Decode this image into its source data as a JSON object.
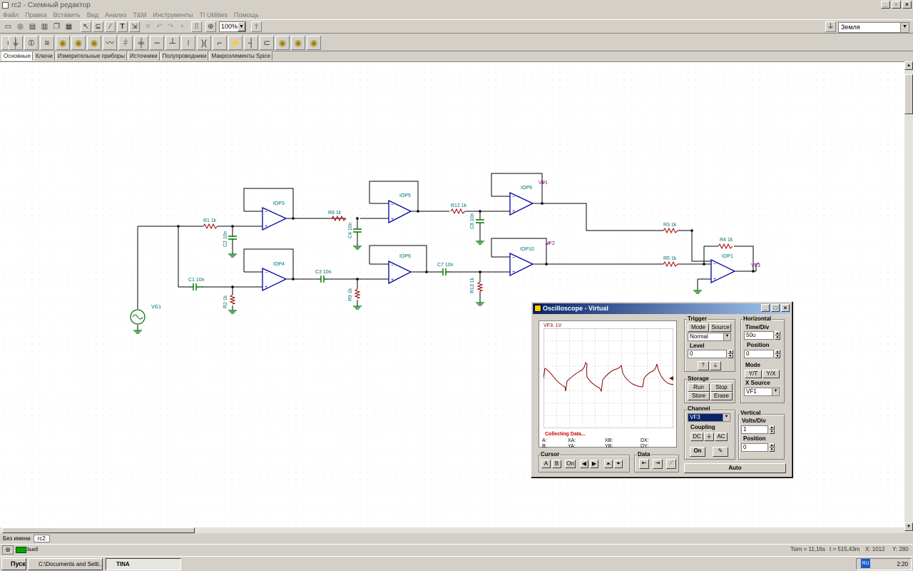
{
  "window": {
    "title": "rc2 - Схемный редактор"
  },
  "menu": [
    "Файл",
    "Правка",
    "Вставить",
    "Вид",
    "Анализ",
    "T&M",
    "Инструменты",
    "TI Utilities",
    "Помощь"
  ],
  "toolbar": {
    "zoom": "100%",
    "ground_select": "Земля"
  },
  "component_tabs": [
    "Основные",
    "Ключи",
    "Измерительные приборы",
    "Источники",
    "Полупроводники",
    "Макроэлементы Spice"
  ],
  "circuit": {
    "labels": {
      "vg1": "VG1",
      "r1": "R1 1k",
      "c2": "C2 10n",
      "iop3": "IOP3",
      "c1": "C1 10n",
      "r2": "R2 1k",
      "iop4": "IOP4",
      "r8": "R8 1k",
      "c4": "C4 10n",
      "iop5": "IOP5",
      "c3": "C3 10n",
      "r9": "R9 1k",
      "iop6": "IOP6",
      "r12": "R12 1k",
      "c8": "C8 10n",
      "iop9": "IOP9",
      "vf1": "VF1",
      "c7": "C7 10n",
      "r13": "R13 1k",
      "iop10": "IOP10",
      "vf2": "VF2",
      "r3": "R3 1k",
      "r4": "R4 1k",
      "r5": "R5 1k",
      "iop1": "IOP1",
      "vf3": "VF3"
    }
  },
  "oscilloscope": {
    "title": "Oscilloscope - Virtual",
    "screen_label": "VF3: 1V",
    "status": "Collecting Data...",
    "readouts": {
      "a": "A:",
      "xa": "XA:",
      "xb": "XB:",
      "dx": "DX:",
      "b": "B:",
      "ya": "YA:",
      "yb": "YB:",
      "dy": "DY:"
    },
    "trigger": {
      "label": "Trigger",
      "mode": "Mode",
      "source": "Source",
      "mode_value": "Normal",
      "level_label": "Level",
      "level": "0"
    },
    "horizontal": {
      "label": "Horizontal",
      "time_div_label": "Time/Div",
      "time_div": "50u",
      "position_label": "Position",
      "position": "0",
      "mode_label": "Mode",
      "yt": "Y/T",
      "yx": "Y/X",
      "xsource_label": "X Source",
      "xsource": "VF1"
    },
    "storage": {
      "label": "Storage",
      "run": "Run",
      "stop": "Stop",
      "store": "Store",
      "erase": "Erase"
    },
    "channel": {
      "label": "Channel",
      "value": "VF3",
      "coupling_label": "Coupling",
      "dc": "DC",
      "ac": "AC",
      "on": "On"
    },
    "vertical": {
      "label": "Vertical",
      "volts_div_label": "Volts/Div",
      "volts_div": "1",
      "position_label": "Position",
      "position": "0"
    },
    "cursor": {
      "label": "Cursor",
      "a": "A",
      "b": "B",
      "on": "On"
    },
    "data_label": "Data",
    "auto": "Auto"
  },
  "sheet_tabs": [
    "Без имени",
    "rc2"
  ],
  "status": {
    "tsim": "Tsim = 11,16s",
    "t": "t = 515,43m",
    "x": "X: 1012",
    "y": "Y: 280",
    "mode": "Зыкб"
  },
  "taskbar": {
    "start": "Пуск",
    "task1": "C:\\Documents and Setti...",
    "task2": "TINA",
    "lang": "RU",
    "clock": "2:20"
  }
}
